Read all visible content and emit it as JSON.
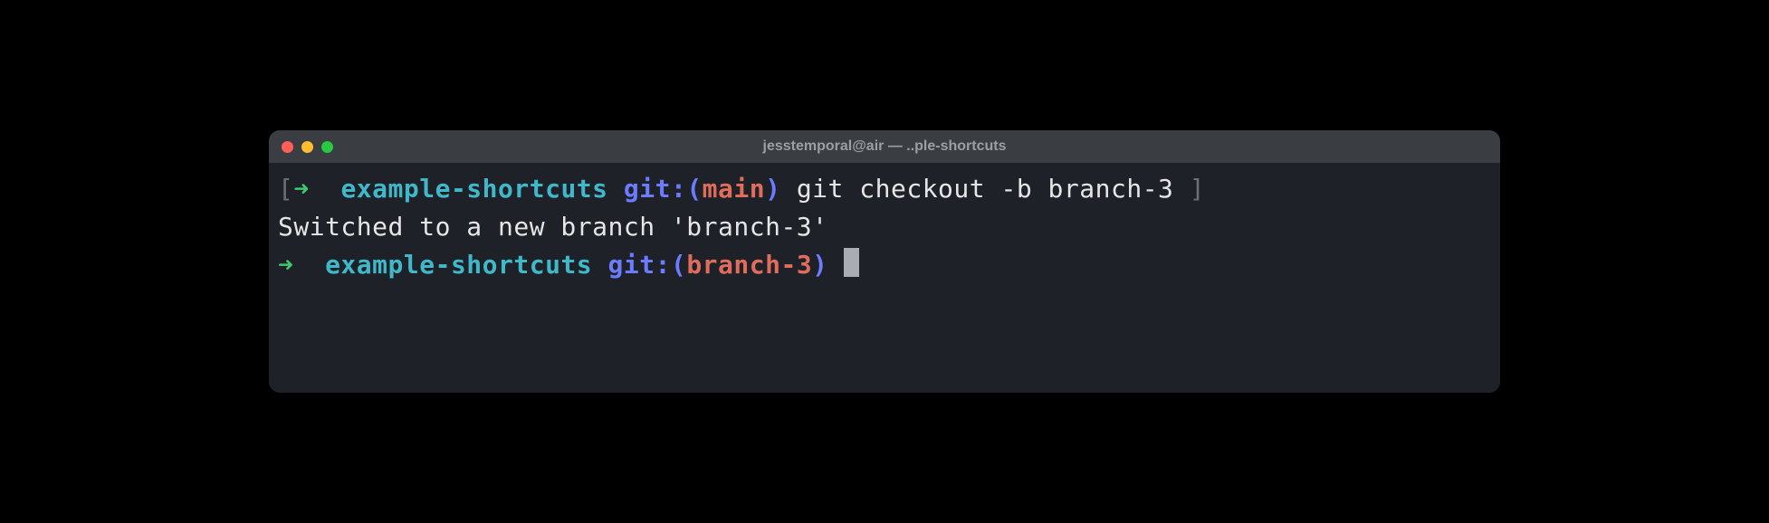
{
  "window": {
    "title": "jesstemporal@air — ..ple-shortcuts"
  },
  "lines": {
    "line1": {
      "bracket_open": "[",
      "arrow": "➜",
      "dir": "example-shortcuts",
      "git_label": "git:",
      "paren_open": "(",
      "branch": "main",
      "paren_close": ")",
      "command": "git checkout -b branch-3",
      "bracket_close": "]"
    },
    "line2": {
      "output": "Switched to a new branch 'branch-3'"
    },
    "line3": {
      "arrow": "➜",
      "dir": "example-shortcuts",
      "git_label": "git:",
      "paren_open": "(",
      "branch": "branch-3",
      "paren_close": ")"
    }
  }
}
